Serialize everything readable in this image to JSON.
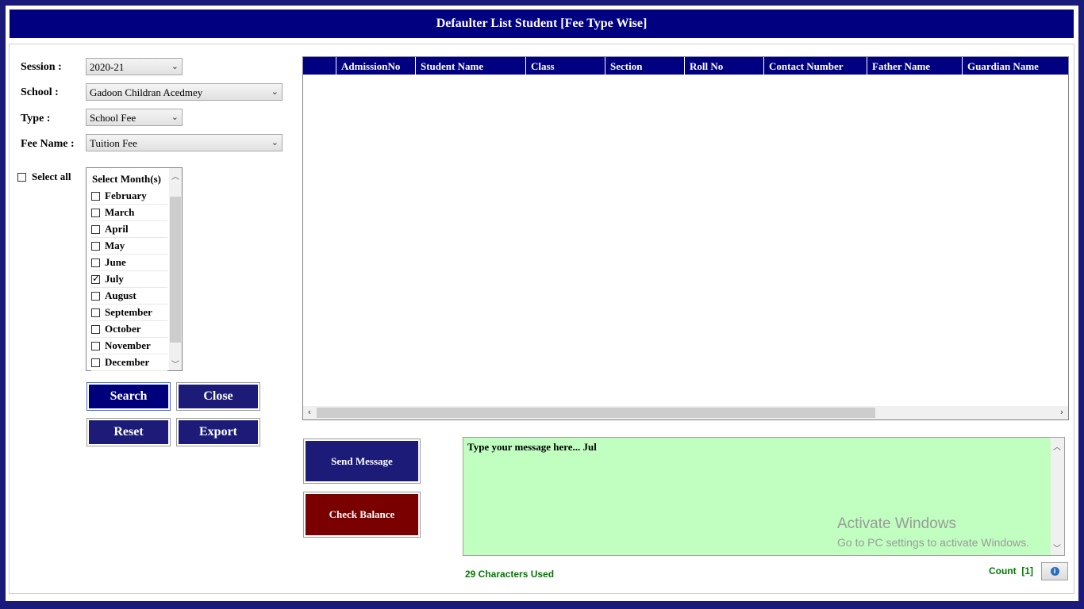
{
  "window": {
    "title": "Defaulter List Student [Fee Type Wise]"
  },
  "form": {
    "session_label": "Session :",
    "session_value": "2020-21",
    "school_label": "School :",
    "school_value": "Gadoon Childran Acedmey",
    "type_label": "Type :",
    "type_value": "School Fee",
    "fee_name_label": "Fee Name :",
    "fee_name_value": "Tuition Fee",
    "select_all_label": "Select all",
    "select_all_checked": false
  },
  "months": {
    "header": "Select Month(s)",
    "items": [
      {
        "label": "February",
        "checked": false
      },
      {
        "label": "March",
        "checked": false
      },
      {
        "label": "April",
        "checked": false
      },
      {
        "label": "May",
        "checked": false
      },
      {
        "label": "June",
        "checked": false
      },
      {
        "label": "July",
        "checked": true
      },
      {
        "label": "August",
        "checked": false
      },
      {
        "label": "September",
        "checked": false
      },
      {
        "label": "October",
        "checked": false
      },
      {
        "label": "November",
        "checked": false
      },
      {
        "label": "December",
        "checked": false
      }
    ]
  },
  "buttons": {
    "search": "Search",
    "close": "Close",
    "reset": "Reset",
    "export": "Export",
    "send_message": "Send Message",
    "check_balance": "Check Balance"
  },
  "grid": {
    "columns": [
      "",
      "AdmissionNo",
      "Student Name",
      "Class",
      "Section",
      "Roll No",
      "Contact Number",
      "Father Name",
      "Guardian Name"
    ],
    "rows": []
  },
  "message": {
    "text": "Type your message here... Jul",
    "chars_used": "29 Characters Used",
    "count_label": "Count  [1]"
  },
  "watermark": {
    "line1": "Activate Windows",
    "line2": "Go to PC settings to activate Windows."
  },
  "colors": {
    "title_bar": "#000080",
    "navy_button": "#1c1c78",
    "check_balance": "#7a0000",
    "message_bg": "#c0ffc0",
    "status_green": "#007a00"
  }
}
